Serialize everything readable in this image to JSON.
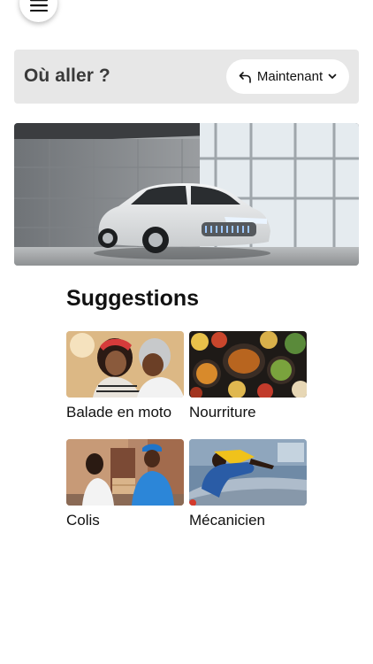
{
  "where": {
    "title": "Où aller ?",
    "time_label": "Maintenant"
  },
  "suggestions": {
    "title": "Suggestions",
    "items": [
      {
        "label": "Balade en moto"
      },
      {
        "label": "Nourriture"
      },
      {
        "label": "Colis"
      },
      {
        "label": "Mécanicien"
      }
    ]
  },
  "icons": {
    "menu": "hamburger-menu-icon",
    "time": "clock-rewind-icon",
    "dropdown": "chevron-down-icon"
  }
}
